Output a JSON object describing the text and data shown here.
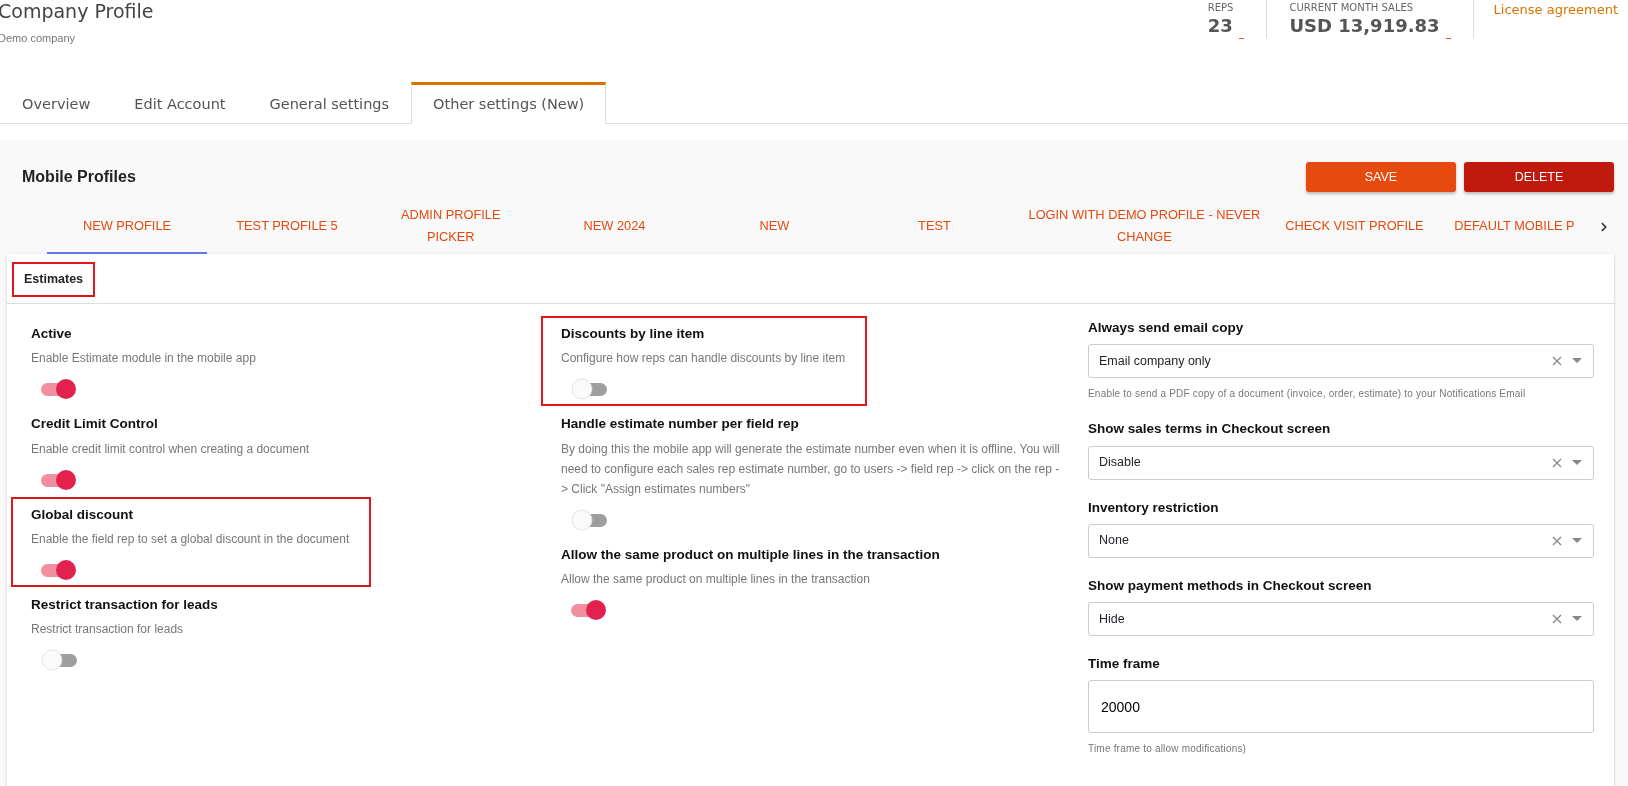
{
  "header": {
    "title": "Company Profile",
    "subtitle": "Demo company",
    "stats": [
      {
        "label": "REPS",
        "value": "23"
      },
      {
        "label": "CURRENT MONTH SALES",
        "value": "USD 13,919.83"
      }
    ],
    "link": "License agreement"
  },
  "tabs": [
    {
      "label": "Overview",
      "selected": false
    },
    {
      "label": "Edit Account",
      "selected": false
    },
    {
      "label": "General settings",
      "selected": false
    },
    {
      "label": "Other settings (New)",
      "selected": true
    }
  ],
  "panel": {
    "title": "Mobile Profiles",
    "buttons": [
      {
        "label": "SAVE",
        "kind": "save"
      },
      {
        "label": "DELETE",
        "kind": "delete"
      }
    ]
  },
  "profile_tabs": [
    {
      "label": "NEW PROFILE",
      "selected": true
    },
    {
      "label": "TEST PROFILE 5",
      "selected": false
    },
    {
      "label": "ADMIN PROFILE PICKER",
      "selected": false
    },
    {
      "label": "NEW 2024",
      "selected": false
    },
    {
      "label": "NEW",
      "selected": false
    },
    {
      "label": "TEST",
      "selected": false
    },
    {
      "label": "LOGIN WITH DEMO PROFILE - NEVER CHANGE",
      "selected": false
    },
    {
      "label": "CHECK VISIT PROFILE",
      "selected": false
    },
    {
      "label": "DEFAULT MOBILE P",
      "selected": false
    }
  ],
  "section": {
    "title": "Estimates",
    "highlighted": true
  },
  "toggle_columns": [
    [
      {
        "label": "Active",
        "description": "Enable Estimate module in the mobile app",
        "on": true,
        "highlighted": false
      },
      {
        "label": "Credit Limit Control",
        "description": "Enable credit limit control when creating a document",
        "on": true,
        "highlighted": false
      },
      {
        "label": "Global discount",
        "description": "Enable the field rep to set a global discount in the document",
        "on": true,
        "highlighted": true
      },
      {
        "label": "Restrict transaction for leads",
        "description": "Restrict transaction for leads",
        "on": false,
        "highlighted": false
      }
    ],
    [
      {
        "label": "Discounts by line item",
        "description": "Configure how reps can handle discounts by line item",
        "on": false,
        "highlighted": true
      },
      {
        "label": "Handle estimate number per field rep",
        "description": "By doing this the mobile app will generate the estimate number even when it is offline. You will need to configure each sales rep estimate number, go to users -> field rep -> click on the rep -> Click \"Assign estimates numbers\"",
        "on": false,
        "highlighted": false
      },
      {
        "label": "Allow the same product on multiple lines in the transaction",
        "description": "Allow the same product on multiple lines in the transaction",
        "on": true,
        "highlighted": false
      }
    ]
  ],
  "fields": [
    {
      "kind": "select",
      "label": "Always send email copy",
      "value": "Email company only",
      "help": "Enable to send a PDF copy of a document (invoice, order, estimate) to your Notifications Email"
    },
    {
      "kind": "select",
      "label": "Show sales terms in Checkout screen",
      "value": "Disable"
    },
    {
      "kind": "select",
      "label": "Inventory restriction",
      "value": "None"
    },
    {
      "kind": "select",
      "label": "Show payment methods in Checkout screen",
      "value": "Hide"
    },
    {
      "kind": "text",
      "label": "Time frame",
      "value": "20000",
      "help": "Time frame to allow modifications)"
    }
  ]
}
